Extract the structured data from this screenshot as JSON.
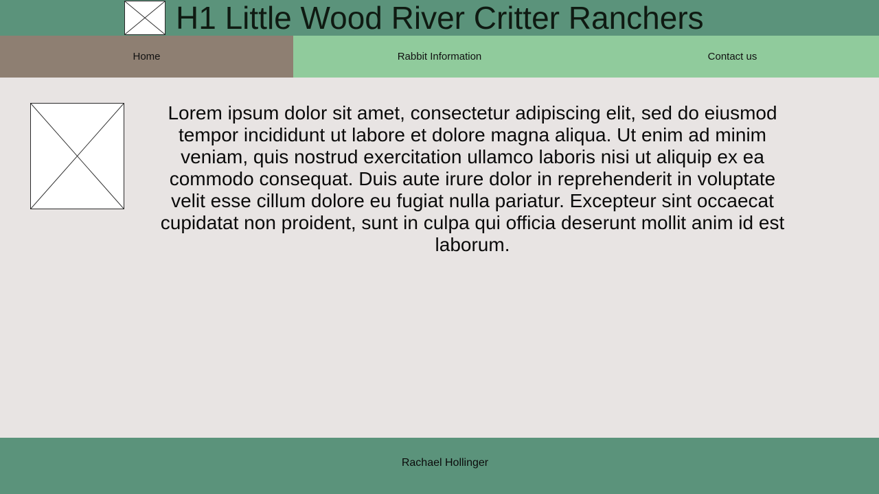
{
  "header": {
    "title": "H1 Little Wood River Critter Ranchers",
    "logo_icon": "broken-image-icon"
  },
  "nav": {
    "items": [
      {
        "label": "Home",
        "active": true
      },
      {
        "label": "Rabbit Information",
        "active": false
      },
      {
        "label": "Contact us",
        "active": false
      }
    ]
  },
  "main": {
    "image_icon": "broken-image-icon",
    "paragraph": "Lorem ipsum dolor sit amet, consectetur adipiscing elit, sed do eiusmod tempor incididunt ut labore et dolore magna aliqua. Ut enim ad minim veniam, quis nostrud exercitation ullamco laboris nisi ut aliquip ex ea commodo consequat. Duis aute irure dolor in reprehenderit in voluptate velit esse cillum dolore eu fugiat nulla pariatur. Excepteur sint occaecat cupidatat non proident, sunt in culpa qui officia deserunt mollit anim id est laborum."
  },
  "footer": {
    "text": "Rachael Hollinger"
  },
  "colors": {
    "header_bg": "#5b937b",
    "nav_bg": "#90cb9c",
    "nav_active_bg": "#8e7f72",
    "page_bg": "#e8e4e3",
    "footer_bg": "#5b937b"
  }
}
